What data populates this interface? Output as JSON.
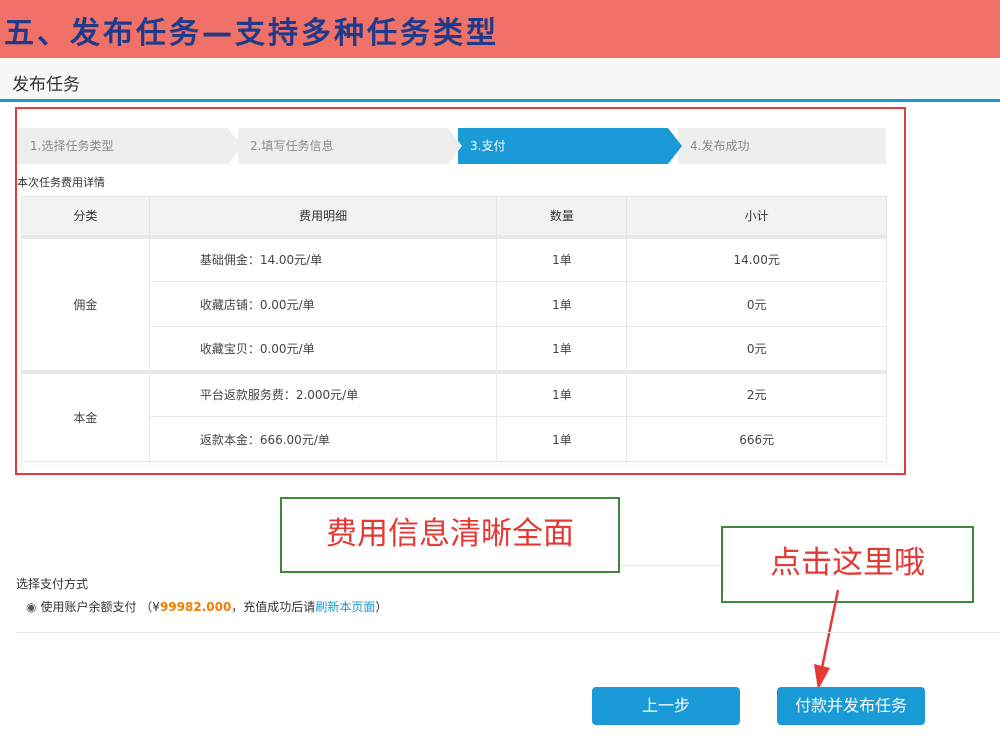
{
  "banner": {
    "title": "五、发布任务—支持多种任务类型"
  },
  "page": {
    "title": "发布任务"
  },
  "steps": [
    {
      "label": "1.选择任务类型",
      "active": false
    },
    {
      "label": "2.填写任务信息",
      "active": false
    },
    {
      "label": "3.支付",
      "active": true
    },
    {
      "label": "4.发布成功",
      "active": false
    }
  ],
  "fee": {
    "caption": "本次任务费用详情",
    "headers": [
      "分类",
      "费用明细",
      "数量",
      "小计"
    ],
    "groups": [
      {
        "category": "佣金",
        "rows": [
          {
            "detail": "基础佣金：14.00元/单",
            "qty": "1单",
            "subtotal": "14.00元"
          },
          {
            "detail": "收藏店铺：0.00元/单",
            "qty": "1单",
            "subtotal": "0元"
          },
          {
            "detail": "收藏宝贝：0.00元/单",
            "qty": "1单",
            "subtotal": "0元"
          }
        ]
      },
      {
        "category": "本金",
        "rows": [
          {
            "detail": "平台返款服务费：2.000元/单",
            "qty": "1单",
            "subtotal": "2元"
          },
          {
            "detail": "返款本金：666.00元/单",
            "qty": "1单",
            "subtotal": "666元"
          }
        ]
      }
    ]
  },
  "annotations": {
    "fee_clear": "费用信息清晰全面",
    "click_here": "点击这里哦"
  },
  "payment": {
    "title": "选择支付方式",
    "option_prefix": "使用账户余额支付 （¥",
    "balance": "99982.000",
    "option_middle": "，充值成功后请",
    "refresh_link": "刷新本页面",
    "option_suffix": "）"
  },
  "buttons": {
    "prev": "上一步",
    "pay_publish": "付款并发布任务"
  },
  "colors": {
    "banner_bg": "#f07167",
    "banner_text": "#1f3a8a",
    "accent": "#1a9ad6",
    "annotation_red": "#e53935",
    "annotation_border": "#3a8a3a",
    "balance": "#f07d00"
  }
}
